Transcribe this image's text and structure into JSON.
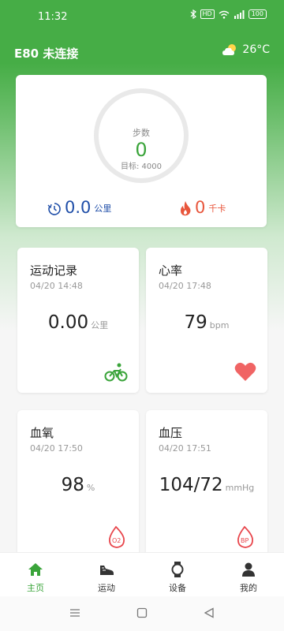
{
  "status": {
    "time": "11:32",
    "network": "HD",
    "signal": "4G",
    "battery": "100"
  },
  "header": {
    "device_title": "E80 未连接",
    "temperature": "26°C"
  },
  "summary": {
    "steps_label": "步数",
    "steps_value": "0",
    "goal_text": "目标: 4000",
    "distance_value": "0.0",
    "distance_unit": "公里",
    "calories_value": "0",
    "calories_unit": "千卡"
  },
  "tiles": [
    {
      "title": "运动记录",
      "time": "04/20 14:48",
      "value": "0.00",
      "unit": "公里",
      "icon": "bicycle-icon"
    },
    {
      "title": "心率",
      "time": "04/20 17:48",
      "value": "79",
      "unit": "bpm",
      "icon": "heart-icon"
    },
    {
      "title": "血氧",
      "time": "04/20 17:50",
      "value": "98",
      "unit": "%",
      "icon": "blood-oxygen-icon"
    },
    {
      "title": "血压",
      "time": "04/20 17:51",
      "value": "104/72",
      "unit": "mmHg",
      "icon": "blood-pressure-icon"
    }
  ],
  "tabs": [
    {
      "label": "主页",
      "icon": "home-icon",
      "active": true
    },
    {
      "label": "运动",
      "icon": "sneaker-icon",
      "active": false
    },
    {
      "label": "设备",
      "icon": "watch-icon",
      "active": false
    },
    {
      "label": "我的",
      "icon": "person-icon",
      "active": false
    }
  ],
  "colors": {
    "brand": "#46ad46",
    "distance": "#1f4ea8",
    "calories": "#e8553b",
    "heart": "#f06464"
  }
}
